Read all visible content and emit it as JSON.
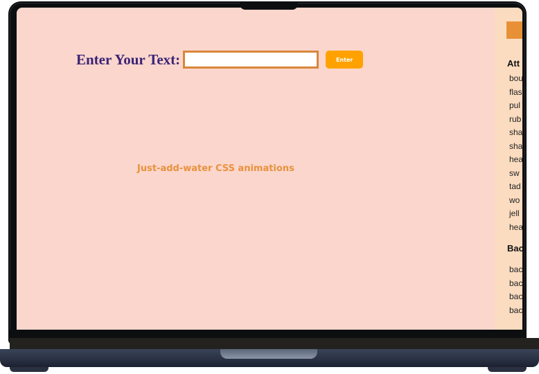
{
  "form": {
    "label": "Enter Your Text:",
    "input_value": "",
    "enter_label": "Enter"
  },
  "tagline": "Just-add-water CSS animations",
  "sidebar": {
    "section_attention": "Att",
    "attention_items": [
      "bou",
      "flas",
      "pul",
      "rub",
      "sha",
      "sha",
      "hea",
      "sw",
      "tad",
      "wo",
      "jell",
      "hea"
    ],
    "section_back": "Bac",
    "back_items": [
      "bac",
      "bac",
      "bac",
      "bac"
    ]
  },
  "colors": {
    "screen_bg": "#fbd6cc",
    "sidebar_bg": "#fbdcc0",
    "accent_orange": "#ffa200",
    "label_purple": "#3a2376",
    "tagline_orange": "#e8923d"
  }
}
